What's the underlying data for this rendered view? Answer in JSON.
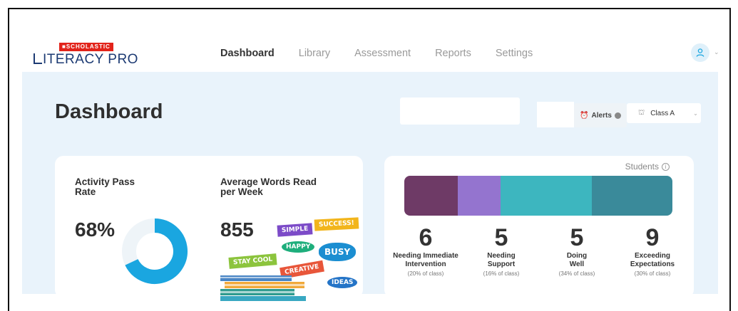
{
  "header": {
    "logo_badge": "■SCHOLASTIC",
    "logo_text": "ITERACY PRO",
    "nav": [
      {
        "label": "Dashboard",
        "active": true
      },
      {
        "label": "Library",
        "active": false
      },
      {
        "label": "Assessment",
        "active": false
      },
      {
        "label": "Reports",
        "active": false
      },
      {
        "label": "Settings",
        "active": false
      }
    ]
  },
  "page": {
    "title": "Dashboard",
    "alerts_label": "Alerts",
    "class_label": "Class A"
  },
  "metrics": {
    "pass_rate_label_1": "Activity Pass",
    "pass_rate_label_2": "Rate",
    "pass_rate_value": "68%",
    "pass_rate_fraction": 0.68,
    "words_label_1": "Average Words Read",
    "words_label_2": "per Week",
    "words_value": "855",
    "stickers": [
      "SIMPLE",
      "SUCCESS!",
      "HAPPY",
      "BUSY",
      "STAY COOL",
      "CREATIVE",
      "IDEAS"
    ]
  },
  "students": {
    "label": "Students",
    "groups": [
      {
        "count": "6",
        "name_1": "Needing Immediate",
        "name_2": "Intervention",
        "pct": "(20% of class)",
        "color": "#6e3a66"
      },
      {
        "count": "5",
        "name_1": "Needing",
        "name_2": "Support",
        "pct": "(16% of class)",
        "color": "#9474cf"
      },
      {
        "count": "5",
        "name_1": "Doing",
        "name_2": "Well",
        "pct": "(34% of class)",
        "color": "#3db6bf"
      },
      {
        "count": "9",
        "name_1": "Exceeding",
        "name_2": "Expectations",
        "pct": "(30% of class)",
        "color": "#3a8a9a"
      }
    ]
  },
  "colors": {
    "accent_blue": "#1aa6e0",
    "logo_red": "#e2231a",
    "logo_navy": "#1c3a73"
  }
}
